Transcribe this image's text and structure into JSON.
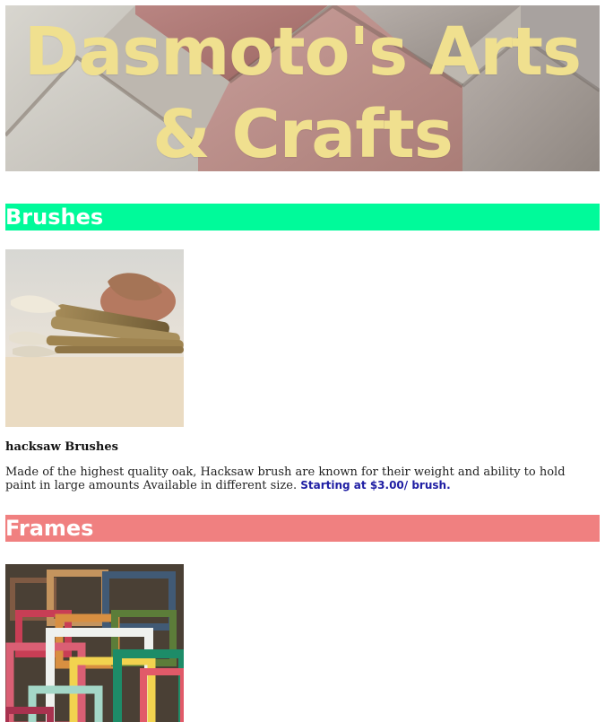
{
  "header": {
    "title": "Dasmoto's Arts & Crafts"
  },
  "sections": {
    "brushes": {
      "heading": "Brushes",
      "image_alt": "Paint brushes on a wooden table",
      "product_title": "hacksaw Brushes",
      "description": "Made of the highest quality oak, Hacksaw brush are known for their weight and ability to hold paint in large amounts Available in different size.",
      "price": "Starting at $3.00/ brush."
    },
    "frames": {
      "heading": "Frames",
      "image_alt": "Stack of colorful picture frames"
    }
  },
  "colors": {
    "title_text": "#f0e08f",
    "brushes_heading_bg": "#00fa9a",
    "frames_heading_bg": "#f08080",
    "price_text": "#1f1ea3"
  }
}
